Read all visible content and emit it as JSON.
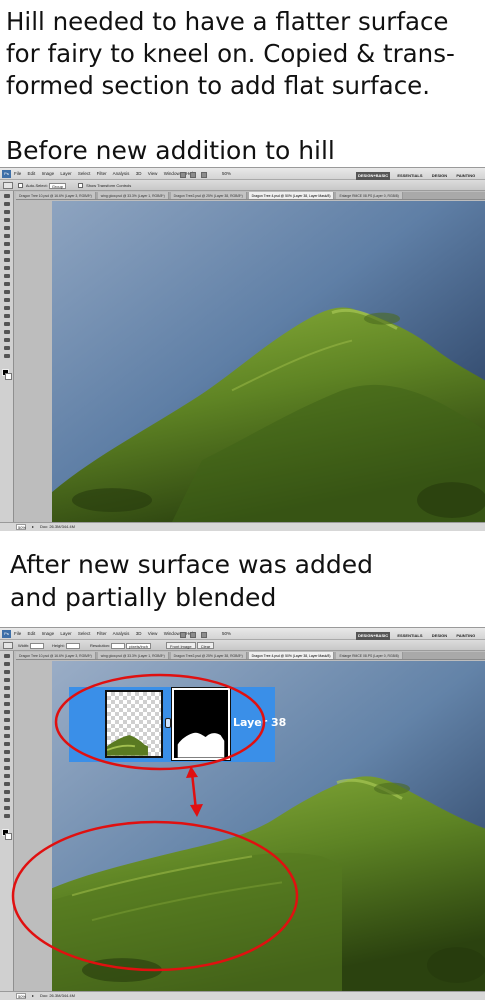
{
  "captions": {
    "intro_lines": [
      "Hill needed to have a flatter surface",
      "for fairy to kneel on. Copied & trans-",
      "formed section to add flat surface."
    ],
    "before": "Before new addition to hill",
    "after_lines": [
      "After new surface was added",
      "and partially blended"
    ]
  },
  "photoshop": {
    "logo": "Ps",
    "menus": [
      "File",
      "Edit",
      "Image",
      "Layer",
      "Select",
      "Filter",
      "Analysis",
      "3D",
      "View",
      "Window",
      "Help"
    ],
    "zoom_menu": "50%",
    "workspaces": [
      "DESIGN+BASIC",
      "ESSENTIALS",
      "DESIGN",
      "PAINTING"
    ],
    "active_workspace": "DESIGN+BASIC",
    "screen_before": {
      "options": {
        "auto_select_label": "Auto-Select:",
        "auto_select_value": "Group",
        "transform_controls": "Show Transform Controls"
      },
      "tabs": [
        "Dragon Tree 10.psd @ 16.6% (Layer 3, RGB/8*)",
        "wing glow.psd @ 33.3% (Layer 1, RGB/8*)",
        "Dragon Tree2.psd @ 25% (Layer 38, RGB/8*)",
        "Dragon Tree 4.psd @ 50% (Layer 38, Layer Mask/8)",
        "Enlarge RMCE 08.PS (Layer 0, RGB/8)"
      ],
      "active_tab_index": 3,
      "status": {
        "zoom": "50%",
        "doc": "Doc: 26.3M/344.4M"
      }
    },
    "screen_after": {
      "options": {
        "width_label": "Width:",
        "height_label": "Height:",
        "resolution_label": "Resolution:",
        "resolution_unit": "pixels/inch",
        "front_image": "Front Image",
        "clear": "Clear"
      },
      "tabs": [
        "Dragon Tree 10.psd @ 16.6% (Layer 3, RGB/8*)",
        "wing glow.psd @ 33.3% (Layer 1, RGB/8*)",
        "Dragon Tree2.psd @ 25% (Layer 38, RGB/8*)",
        "Dragon Tree 4.psd @ 50% (Layer 38, Layer Mask/8)",
        "Enlarge RMCE 08.PS (Layer 0, RGB/8)"
      ],
      "active_tab_index": 3,
      "layer_panel": {
        "layer_name": "Layer 38"
      },
      "status": {
        "zoom": "50%",
        "doc": "Doc: 26.3M/344.4M"
      }
    }
  },
  "colors": {
    "sea_light": "#8fa6c2",
    "sea_dark": "#1f3456",
    "grass_light": "#8fb23a",
    "grass_dark": "#2d4510",
    "annotation_red": "#e01010",
    "layer_selected": "#3a8fe8"
  }
}
